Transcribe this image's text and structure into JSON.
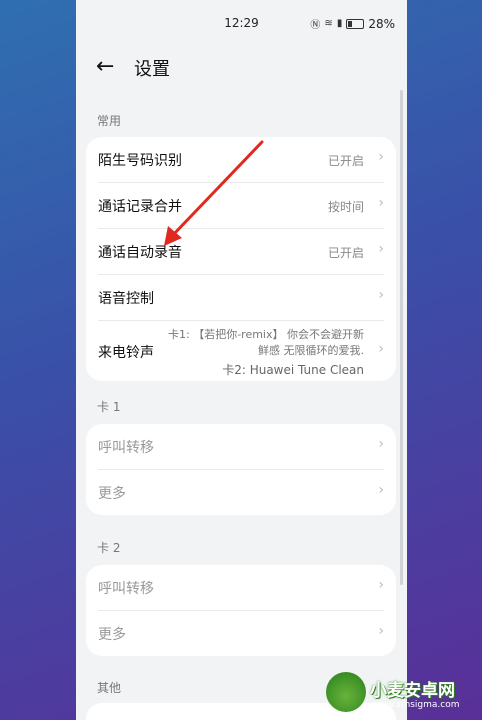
{
  "status_bar": {
    "time": "12:29",
    "battery": "28%",
    "icons": [
      "nfc-icon",
      "wifi-icon",
      "signal-icon",
      "battery-icon"
    ]
  },
  "header": {
    "back_icon": "←",
    "title": "设置"
  },
  "sections": {
    "common": {
      "label": "常用",
      "rows": [
        {
          "label": "陌生号码识别",
          "value": "已开启"
        },
        {
          "label": "通话记录合并",
          "value": "按时间"
        },
        {
          "label": "通话自动录音",
          "value": "已开启"
        },
        {
          "label": "语音控制",
          "value": ""
        },
        {
          "label": "来电铃声",
          "ring_line1": "卡1: 【若把你-remix】 你会不会避开新鲜感 无限循环的爱我.",
          "ring_line2": "卡2: Huawei Tune Clean"
        }
      ]
    },
    "card1": {
      "label": "卡 1",
      "rows": [
        {
          "label": "呼叫转移"
        },
        {
          "label": "更多"
        }
      ]
    },
    "card2": {
      "label": "卡 2",
      "rows": [
        {
          "label": "呼叫转移"
        },
        {
          "label": "更多"
        }
      ]
    },
    "other": {
      "label": "其他"
    }
  },
  "chevron": "›",
  "annotation": {
    "type": "red-arrow",
    "color": "#e02a1f"
  },
  "watermark": {
    "title": "小麦安卓网",
    "url": "www.xmsigma.com",
    "logo_color": "#4a9e2c"
  }
}
